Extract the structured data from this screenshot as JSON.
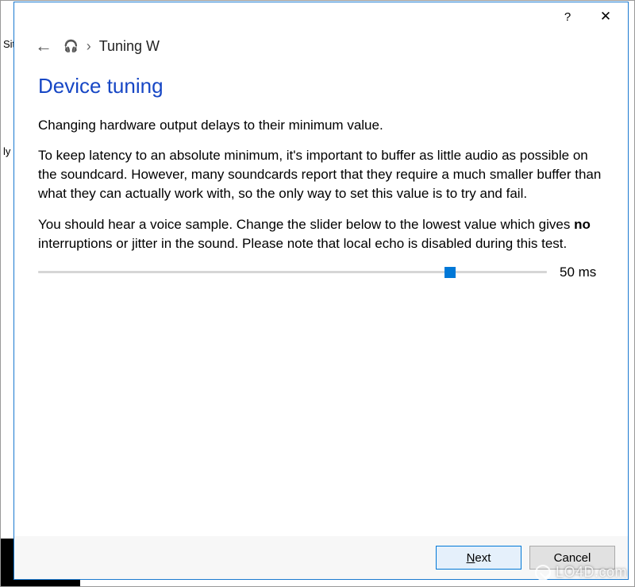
{
  "background": {
    "fragment_left_top": "Sit",
    "fragment_left_mid": "ly"
  },
  "titlebar": {
    "help_symbol": "?",
    "close_symbol": "✕"
  },
  "breadcrumb": {
    "back_symbol": "←",
    "icon_symbol": "🎧",
    "sep_symbol": "›",
    "label": "Tuning W"
  },
  "heading": "Device tuning",
  "paragraph1": "Changing hardware output delays to their minimum value.",
  "paragraph2": "To keep latency to an absolute minimum, it's important to buffer as little audio as possible on the soundcard. However, many soundcards report that they require a much smaller buffer than what they can actually work with, so the only way to set this value is to try and fail.",
  "paragraph3_pre": "You should hear a voice sample. Change the slider below to the lowest value which gives ",
  "paragraph3_bold": "no",
  "paragraph3_post": " interruptions or jitter in the sound. Please note that local echo is disabled during this test.",
  "slider": {
    "value_label": "50 ms"
  },
  "buttons": {
    "next_mnemonic": "N",
    "next_rest": "ext",
    "cancel": "Cancel"
  },
  "watermark": "LO4D.com"
}
